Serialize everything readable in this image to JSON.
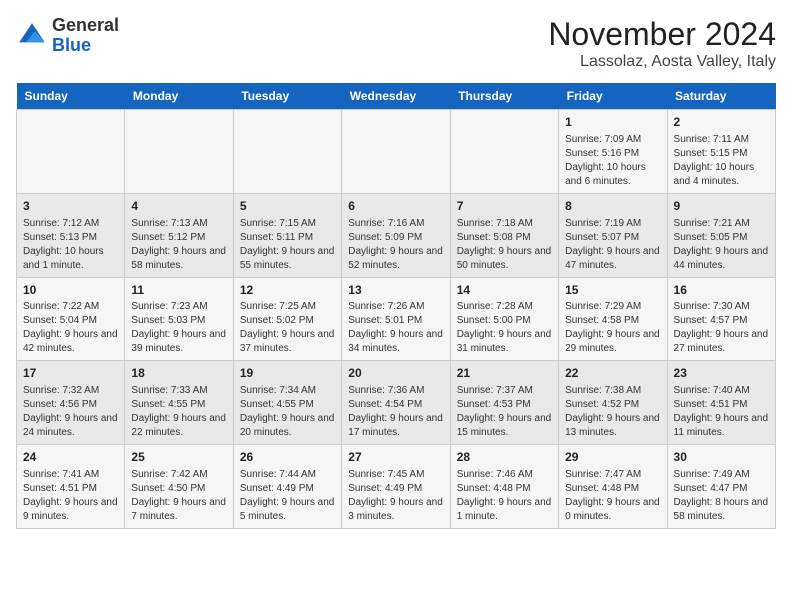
{
  "header": {
    "logo_general": "General",
    "logo_blue": "Blue",
    "month_title": "November 2024",
    "location": "Lassolaz, Aosta Valley, Italy"
  },
  "calendar": {
    "days_of_week": [
      "Sunday",
      "Monday",
      "Tuesday",
      "Wednesday",
      "Thursday",
      "Friday",
      "Saturday"
    ],
    "weeks": [
      [
        {
          "day": "",
          "info": ""
        },
        {
          "day": "",
          "info": ""
        },
        {
          "day": "",
          "info": ""
        },
        {
          "day": "",
          "info": ""
        },
        {
          "day": "",
          "info": ""
        },
        {
          "day": "1",
          "info": "Sunrise: 7:09 AM\nSunset: 5:16 PM\nDaylight: 10 hours and 6 minutes."
        },
        {
          "day": "2",
          "info": "Sunrise: 7:11 AM\nSunset: 5:15 PM\nDaylight: 10 hours and 4 minutes."
        }
      ],
      [
        {
          "day": "3",
          "info": "Sunrise: 7:12 AM\nSunset: 5:13 PM\nDaylight: 10 hours and 1 minute."
        },
        {
          "day": "4",
          "info": "Sunrise: 7:13 AM\nSunset: 5:12 PM\nDaylight: 9 hours and 58 minutes."
        },
        {
          "day": "5",
          "info": "Sunrise: 7:15 AM\nSunset: 5:11 PM\nDaylight: 9 hours and 55 minutes."
        },
        {
          "day": "6",
          "info": "Sunrise: 7:16 AM\nSunset: 5:09 PM\nDaylight: 9 hours and 52 minutes."
        },
        {
          "day": "7",
          "info": "Sunrise: 7:18 AM\nSunset: 5:08 PM\nDaylight: 9 hours and 50 minutes."
        },
        {
          "day": "8",
          "info": "Sunrise: 7:19 AM\nSunset: 5:07 PM\nDaylight: 9 hours and 47 minutes."
        },
        {
          "day": "9",
          "info": "Sunrise: 7:21 AM\nSunset: 5:05 PM\nDaylight: 9 hours and 44 minutes."
        }
      ],
      [
        {
          "day": "10",
          "info": "Sunrise: 7:22 AM\nSunset: 5:04 PM\nDaylight: 9 hours and 42 minutes."
        },
        {
          "day": "11",
          "info": "Sunrise: 7:23 AM\nSunset: 5:03 PM\nDaylight: 9 hours and 39 minutes."
        },
        {
          "day": "12",
          "info": "Sunrise: 7:25 AM\nSunset: 5:02 PM\nDaylight: 9 hours and 37 minutes."
        },
        {
          "day": "13",
          "info": "Sunrise: 7:26 AM\nSunset: 5:01 PM\nDaylight: 9 hours and 34 minutes."
        },
        {
          "day": "14",
          "info": "Sunrise: 7:28 AM\nSunset: 5:00 PM\nDaylight: 9 hours and 31 minutes."
        },
        {
          "day": "15",
          "info": "Sunrise: 7:29 AM\nSunset: 4:58 PM\nDaylight: 9 hours and 29 minutes."
        },
        {
          "day": "16",
          "info": "Sunrise: 7:30 AM\nSunset: 4:57 PM\nDaylight: 9 hours and 27 minutes."
        }
      ],
      [
        {
          "day": "17",
          "info": "Sunrise: 7:32 AM\nSunset: 4:56 PM\nDaylight: 9 hours and 24 minutes."
        },
        {
          "day": "18",
          "info": "Sunrise: 7:33 AM\nSunset: 4:55 PM\nDaylight: 9 hours and 22 minutes."
        },
        {
          "day": "19",
          "info": "Sunrise: 7:34 AM\nSunset: 4:55 PM\nDaylight: 9 hours and 20 minutes."
        },
        {
          "day": "20",
          "info": "Sunrise: 7:36 AM\nSunset: 4:54 PM\nDaylight: 9 hours and 17 minutes."
        },
        {
          "day": "21",
          "info": "Sunrise: 7:37 AM\nSunset: 4:53 PM\nDaylight: 9 hours and 15 minutes."
        },
        {
          "day": "22",
          "info": "Sunrise: 7:38 AM\nSunset: 4:52 PM\nDaylight: 9 hours and 13 minutes."
        },
        {
          "day": "23",
          "info": "Sunrise: 7:40 AM\nSunset: 4:51 PM\nDaylight: 9 hours and 11 minutes."
        }
      ],
      [
        {
          "day": "24",
          "info": "Sunrise: 7:41 AM\nSunset: 4:51 PM\nDaylight: 9 hours and 9 minutes."
        },
        {
          "day": "25",
          "info": "Sunrise: 7:42 AM\nSunset: 4:50 PM\nDaylight: 9 hours and 7 minutes."
        },
        {
          "day": "26",
          "info": "Sunrise: 7:44 AM\nSunset: 4:49 PM\nDaylight: 9 hours and 5 minutes."
        },
        {
          "day": "27",
          "info": "Sunrise: 7:45 AM\nSunset: 4:49 PM\nDaylight: 9 hours and 3 minutes."
        },
        {
          "day": "28",
          "info": "Sunrise: 7:46 AM\nSunset: 4:48 PM\nDaylight: 9 hours and 1 minute."
        },
        {
          "day": "29",
          "info": "Sunrise: 7:47 AM\nSunset: 4:48 PM\nDaylight: 9 hours and 0 minutes."
        },
        {
          "day": "30",
          "info": "Sunrise: 7:49 AM\nSunset: 4:47 PM\nDaylight: 8 hours and 58 minutes."
        }
      ]
    ]
  }
}
